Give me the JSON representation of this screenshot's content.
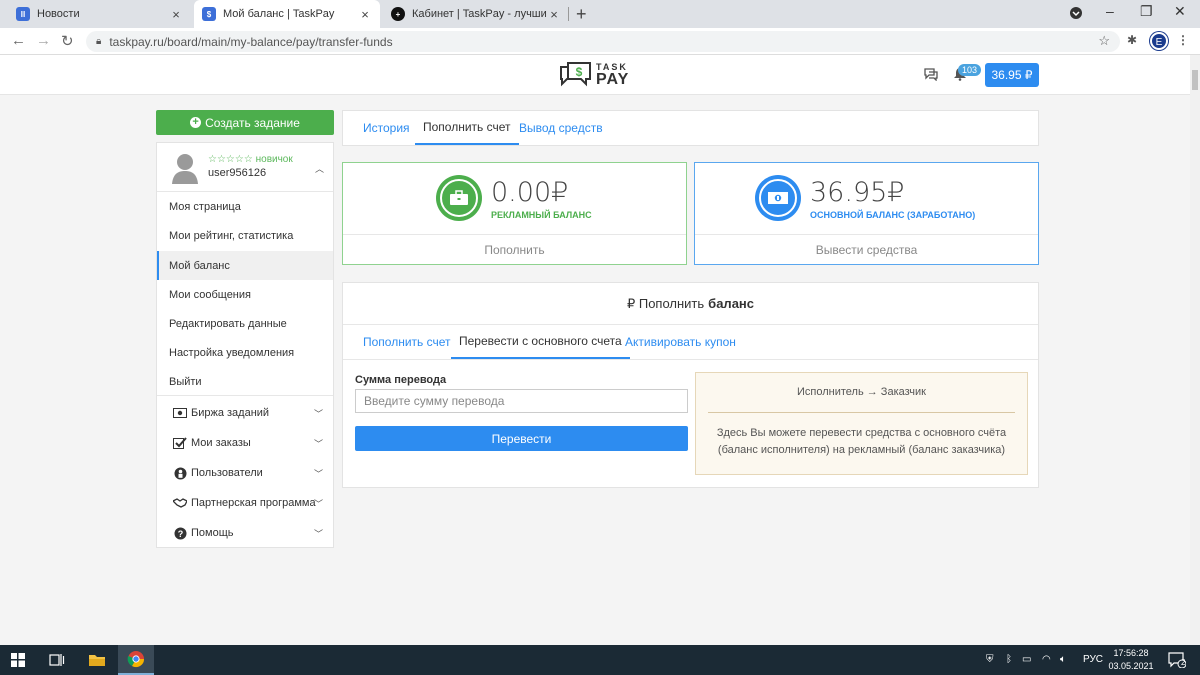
{
  "browser": {
    "tabs": [
      {
        "title": "Новости"
      },
      {
        "title": "Мой баланс | TaskPay"
      },
      {
        "title": "Кабинет | TaskPay - лучший про"
      }
    ],
    "url": "taskpay.ru/board/main/my-balance/pay/transfer-funds",
    "profile_initial": "E"
  },
  "header": {
    "logo_line1": "TASK",
    "logo_line2": "PAY",
    "notifications_count": "103",
    "balance": "36.95 ₽"
  },
  "sidebar": {
    "create_task": "Создать задание",
    "user": {
      "rank_stars": "☆☆☆☆☆",
      "rank": "новичок",
      "name": "user956126"
    },
    "menu": [
      {
        "label": "Моя страница"
      },
      {
        "label": "Мои рейтинг, статистика"
      },
      {
        "label": "Мой баланс"
      },
      {
        "label": "Мои сообщения"
      },
      {
        "label": "Редактировать данные"
      },
      {
        "label": "Настройка уведомления"
      },
      {
        "label": "Выйти"
      }
    ],
    "groups": [
      {
        "label": "Биржа заданий",
        "icon": "money-icon"
      },
      {
        "label": "Мои заказы",
        "icon": "check-icon"
      },
      {
        "label": "Пользователи",
        "icon": "users-icon"
      },
      {
        "label": "Партнерская программа",
        "icon": "handshake-icon"
      },
      {
        "label": "Помощь",
        "icon": "help-icon"
      }
    ]
  },
  "main": {
    "tabs": [
      {
        "label": "История"
      },
      {
        "label": "Пополнить счет"
      },
      {
        "label": "Вывод средств"
      }
    ],
    "ad_balance": {
      "amount": "0.00",
      "currency": "₽",
      "label": "РЕКЛАМНЫЙ БАЛАНС",
      "action": "Пополнить"
    },
    "main_balance": {
      "amount": "36.95",
      "currency": "₽",
      "label": "ОСНОВНОЙ БАЛАНС (ЗАРАБОТАНО)",
      "action": "Вывести средства"
    },
    "panel": {
      "title_prefix": "₽ Пополнить",
      "title_bold": "баланс",
      "tabs": [
        {
          "label": "Пополнить счет"
        },
        {
          "label": "Перевести с основного счета"
        },
        {
          "label": "Активировать купон"
        }
      ],
      "field_label": "Сумма перевода",
      "field_placeholder": "Введите сумму перевода",
      "submit": "Перевести",
      "info_title": "Исполнитель → Заказчик",
      "info_text": "Здесь Вы можете перевести средства с основного счёта (баланс исполнителя) на рекламный (баланс заказчика)"
    }
  },
  "taskbar": {
    "lang": "РУС",
    "time": "17:56:28",
    "date": "03.05.2021",
    "notifications": "2"
  },
  "colors": {
    "accent": "#2d8cf0",
    "success": "#4cae4c"
  }
}
